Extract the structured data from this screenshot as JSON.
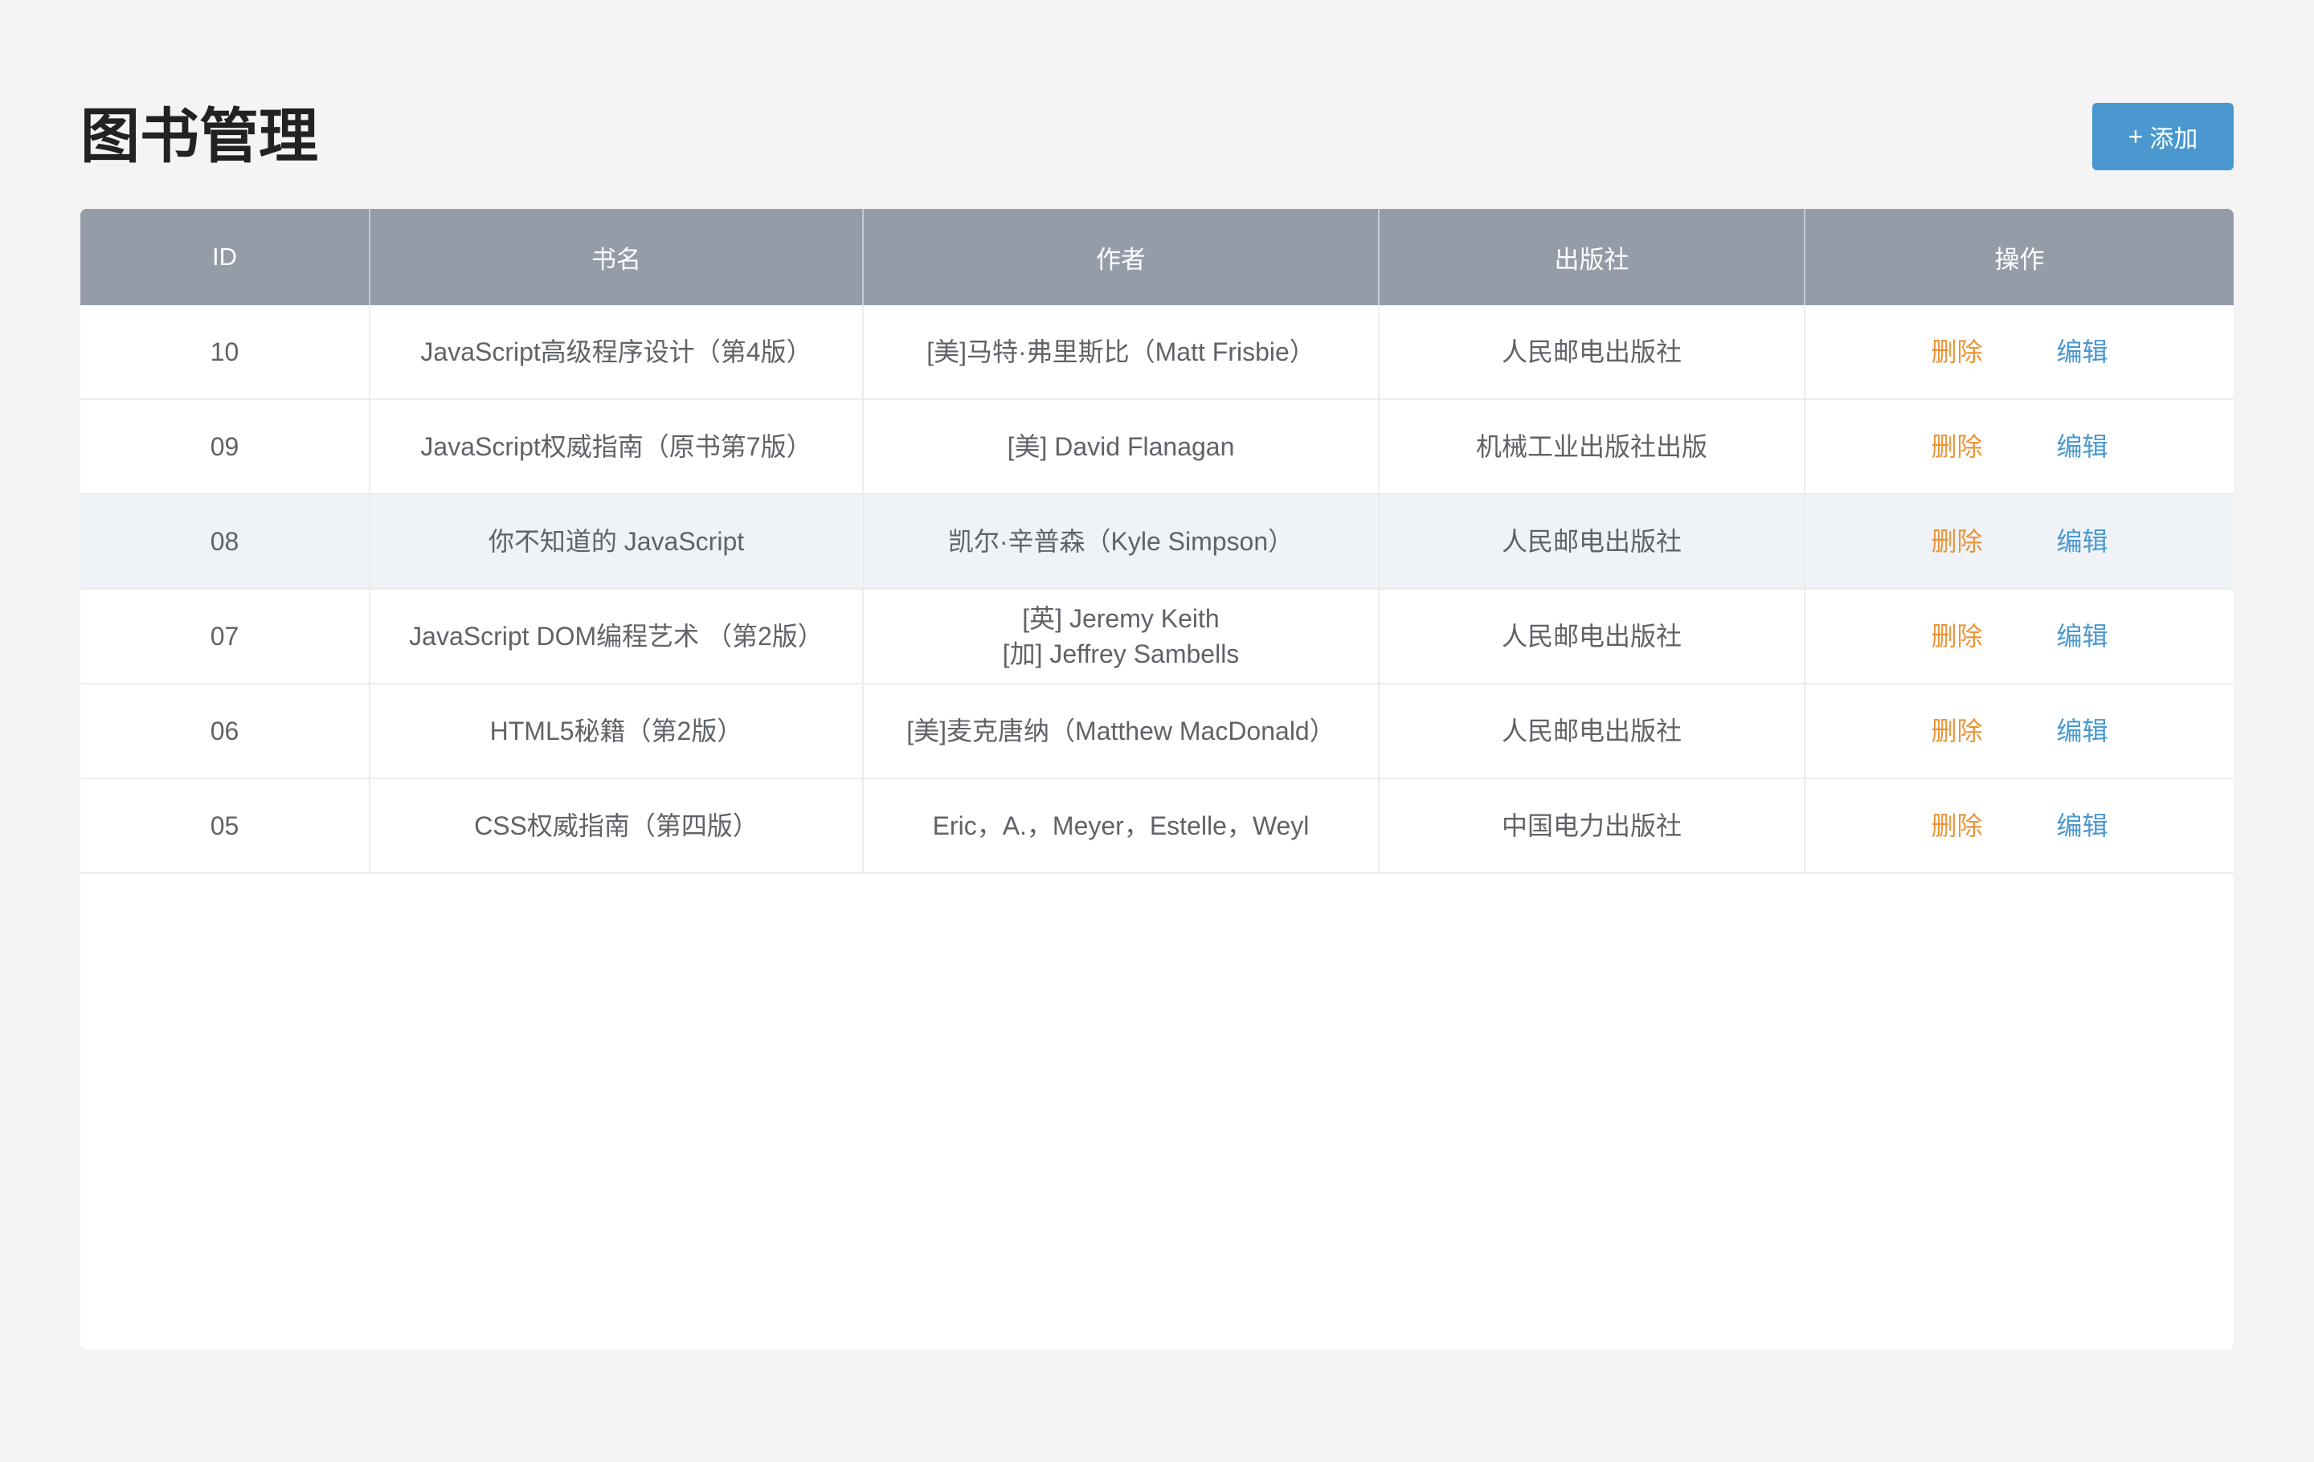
{
  "page": {
    "title": "图书管理",
    "add_button": {
      "icon": "+",
      "label": "添加"
    }
  },
  "table": {
    "columns": [
      "ID",
      "书名",
      "作者",
      "出版社",
      "操作"
    ],
    "rows": [
      {
        "id": "10",
        "title": "JavaScript高级程序设计（第4版）",
        "author": [
          "[美]马特·弗里斯比（Matt Frisbie）"
        ],
        "publisher": "人民邮电出版社",
        "delete_label": "删除",
        "edit_label": "编辑"
      },
      {
        "id": "09",
        "title": "JavaScript权威指南（原书第7版）",
        "author": [
          "[美] David Flanagan"
        ],
        "publisher": "机械工业出版社出版",
        "delete_label": "删除",
        "edit_label": "编辑"
      },
      {
        "id": "08",
        "title": "你不知道的 JavaScript",
        "author": [
          "凯尔·辛普森（Kyle Simpson）"
        ],
        "publisher": "人民邮电出版社",
        "delete_label": "删除",
        "edit_label": "编辑"
      },
      {
        "id": "07",
        "title": "JavaScript DOM编程艺术 （第2版）",
        "author": [
          "[英] Jeremy Keith",
          "[加] Jeffrey Sambells"
        ],
        "publisher": "人民邮电出版社",
        "delete_label": "删除",
        "edit_label": "编辑"
      },
      {
        "id": "06",
        "title": "HTML5秘籍（第2版）",
        "author": [
          "[美]麦克唐纳（Matthew MacDonald）"
        ],
        "publisher": "人民邮电出版社",
        "delete_label": "删除",
        "edit_label": "编辑"
      },
      {
        "id": "05",
        "title": "CSS权威指南（第四版）",
        "author": [
          "Eric，A.，Meyer，Estelle，Weyl"
        ],
        "publisher": "中国电力出版社",
        "delete_label": "删除",
        "edit_label": "编辑"
      }
    ],
    "hovered_row_index": 2
  },
  "colors": {
    "accent": "#4a98cf",
    "delete": "#e8953a",
    "header_bg": "#949ca8",
    "hover_row": "#eff3f8"
  }
}
